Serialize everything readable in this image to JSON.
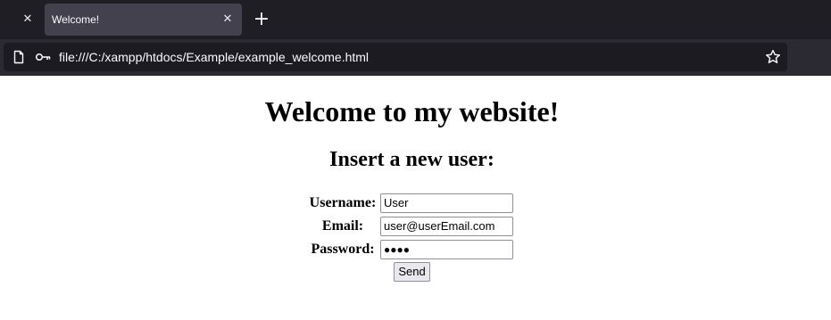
{
  "browser": {
    "inactive_tab_close_glyph": "✕",
    "active_tab": {
      "title": "Welcome!",
      "close_glyph": "✕"
    },
    "new_tab_glyph": "+",
    "url": "file:///C:/xampp/htdocs/Example/example_welcome.html",
    "icons": [
      "page-icon",
      "key-icon",
      "star-icon"
    ],
    "colors": {
      "tabstrip": "#1f1e25",
      "active_tab": "#42414d",
      "toolbar": "#2b2a33",
      "urlbar": "#1c1b22"
    }
  },
  "page": {
    "heading": "Welcome to my website!",
    "subheading": "Insert a new user:",
    "form": {
      "username_label": "Username:",
      "username_value": "User",
      "email_label": "Email:",
      "email_value": "user@userEmail.com",
      "password_label": "Password:",
      "password_masked": "●●●●",
      "submit_label": "Send"
    }
  }
}
